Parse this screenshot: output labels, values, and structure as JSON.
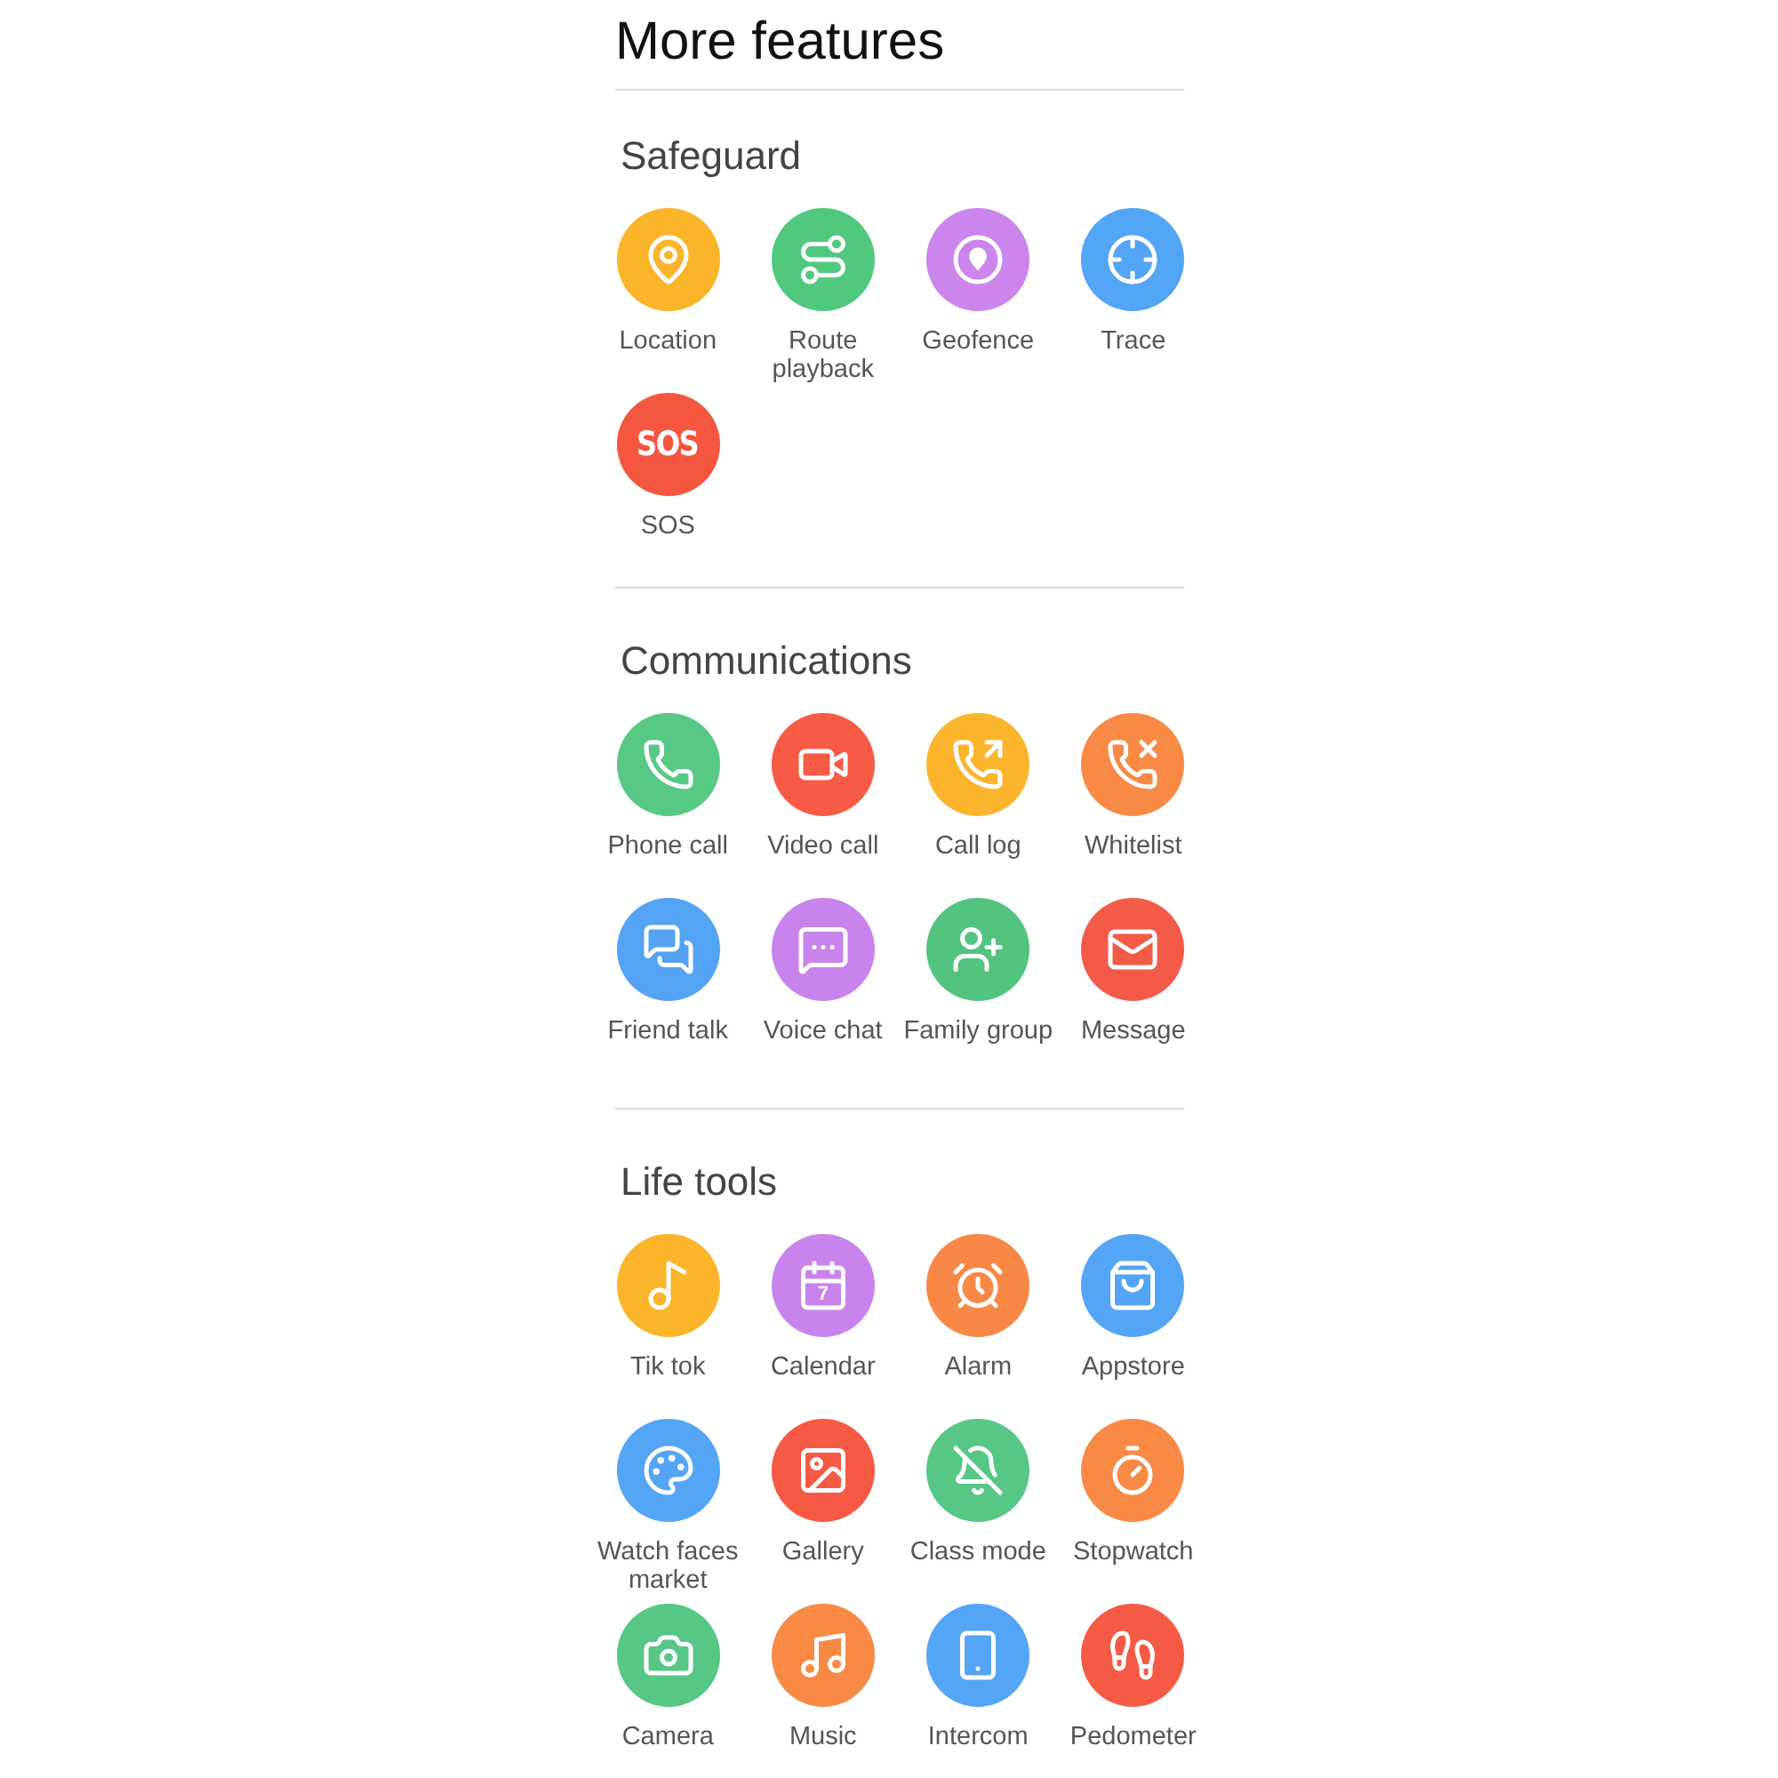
{
  "title": "More features",
  "sections": [
    {
      "title": "Safeguard",
      "items": [
        {
          "label": "Location",
          "kind": "location",
          "color": "#fbb52a"
        },
        {
          "label": "Route\nplayback",
          "kind": "route",
          "color": "#50c97f"
        },
        {
          "label": "Geofence",
          "kind": "geofence",
          "color": "#cc85ec"
        },
        {
          "label": "Trace",
          "kind": "trace",
          "color": "#53a5f6"
        },
        {
          "label": "SOS",
          "kind": "sos",
          "icon_text": "SOS",
          "color": "#f5563f"
        }
      ]
    },
    {
      "title": "Communications",
      "items": [
        {
          "label": "Phone call",
          "kind": "phone",
          "color": "#57c985"
        },
        {
          "label": "Video call",
          "kind": "video",
          "color": "#f75b45"
        },
        {
          "label": "Call log",
          "kind": "call_log",
          "color": "#fbb52c"
        },
        {
          "label": "Whitelist",
          "kind": "whitelist",
          "color": "#f88a45"
        },
        {
          "label": "Friend talk",
          "kind": "friend_talk",
          "color": "#54a3f5"
        },
        {
          "label": "Voice chat",
          "kind": "voice_chat",
          "color": "#c983ec"
        },
        {
          "label": "Family group",
          "kind": "family",
          "color": "#53c47f"
        },
        {
          "label": "Message",
          "kind": "message",
          "color": "#f45a48"
        }
      ]
    },
    {
      "title": "Life tools",
      "items": [
        {
          "label": "Tik tok",
          "kind": "tiktok",
          "color": "#fbb52a"
        },
        {
          "label": "Calendar",
          "kind": "calendar",
          "icon_text": "7",
          "color": "#c983ec"
        },
        {
          "label": "Alarm",
          "kind": "alarm",
          "color": "#f88845"
        },
        {
          "label": "Appstore",
          "kind": "appstore",
          "color": "#54a5f6"
        },
        {
          "label": "Watch faces\nmarket",
          "kind": "watch_faces",
          "color": "#54a5f6"
        },
        {
          "label": "Gallery",
          "kind": "gallery",
          "color": "#f65a45"
        },
        {
          "label": "Class mode",
          "kind": "class_mode",
          "color": "#56c785"
        },
        {
          "label": "Stopwatch",
          "kind": "stopwatch",
          "color": "#f88a45"
        },
        {
          "label": "Camera",
          "kind": "camera",
          "color": "#56c785"
        },
        {
          "label": "Music",
          "kind": "music",
          "color": "#f88a45"
        },
        {
          "label": "Intercom",
          "kind": "intercom",
          "color": "#54a5f6"
        },
        {
          "label": "Pedometer",
          "kind": "pedometer",
          "color": "#f55a45"
        }
      ]
    }
  ]
}
